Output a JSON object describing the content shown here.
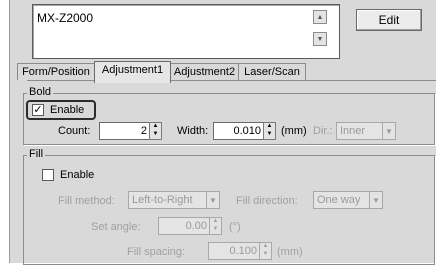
{
  "listbox": {
    "value": "MX-Z2000"
  },
  "edit_button": {
    "label": "Edit"
  },
  "tabs": [
    {
      "label": "Form/Position"
    },
    {
      "label": "Adjustment1"
    },
    {
      "label": "Adjustment2"
    },
    {
      "label": "Laser/Scan"
    }
  ],
  "bold": {
    "group_label": "Bold",
    "enable_label": "Enable",
    "enable_checked": "✓",
    "count_label": "Count:",
    "count_value": "2",
    "width_label": "Width:",
    "width_value": "0.010",
    "width_unit": "(mm)",
    "dir_label": "Dir.:",
    "dir_value": "Inner"
  },
  "fill": {
    "group_label": "Fill",
    "enable_label": "Enable",
    "method_label": "Fill method:",
    "method_value": "Left-to-Right",
    "direction_label": "Fill direction:",
    "direction_value": "One way",
    "angle_label": "Set angle:",
    "angle_value": "0.00",
    "angle_unit": "(°)",
    "spacing_label": "Fill spacing:",
    "spacing_value": "0.100",
    "spacing_unit": "(mm)"
  },
  "icons": {
    "up": "▲",
    "down": "▼"
  },
  "colors": {
    "panel": "#d9d9d9",
    "highlight": "#2c2c2c"
  }
}
